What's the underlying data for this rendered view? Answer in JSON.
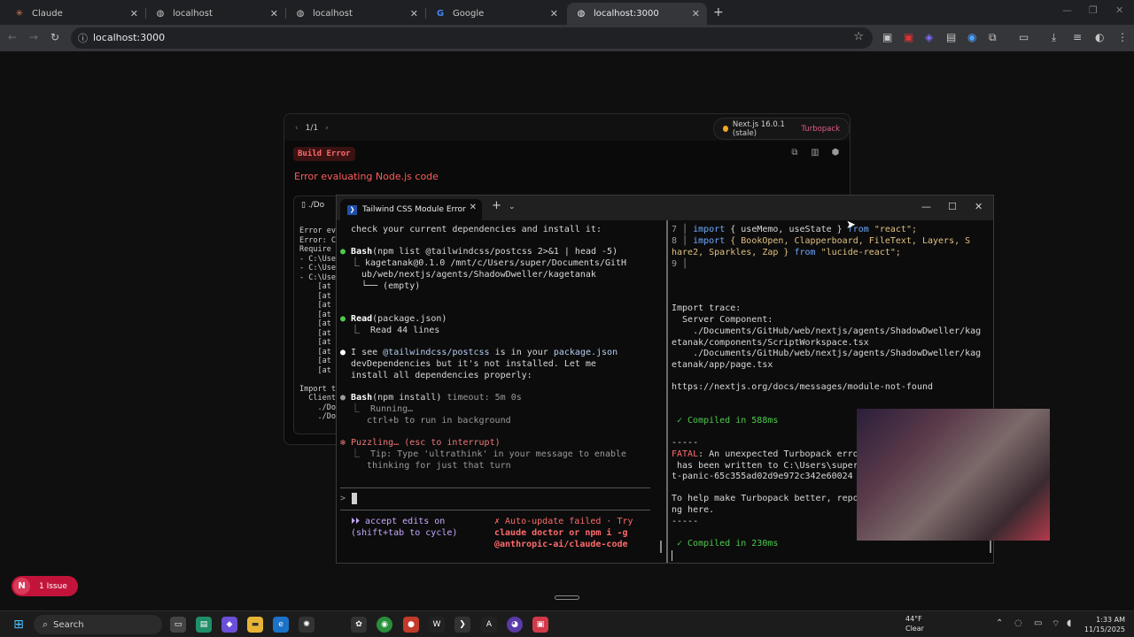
{
  "browser": {
    "tabs": [
      {
        "title": "Claude",
        "active": false
      },
      {
        "title": "localhost",
        "active": false
      },
      {
        "title": "localhost",
        "active": false
      },
      {
        "title": "Google",
        "active": false
      },
      {
        "title": "localhost:3000",
        "active": true
      }
    ],
    "url": "localhost:3000"
  },
  "overlay": {
    "pager": "1/1",
    "nextjs_version": "Next.js 16.0.1 (stale)",
    "bundler": "Turbopack",
    "badge": "Build Error",
    "title": "Error evaluating Node.js code",
    "file": "./Do",
    "code_lines": [
      "Error eva",
      "Error: Ca",
      "Require s",
      "- C:\\User",
      "- C:\\User",
      "- C:\\User",
      "    [at K",
      "    [at c",
      "    [at s",
      "    [at K",
      "    [at t",
      "    [at v",
      "    [at K",
      "    [at b",
      "    [at a",
      "    [at r",
      "",
      "Import tr",
      "  Client",
      "    ./Doc",
      "    ./Doc"
    ]
  },
  "terminal": {
    "tab_title": "Tailwind CSS Module Error",
    "left": {
      "l1": "check your current dependencies and install it:",
      "bash1_cmd": "Bash",
      "bash1_args": "(npm list @tailwindcss/postcss 2>&1 | head -5)",
      "bash1_out1": "⎿ kagetanak@0.1.0 /mnt/c/Users/super/Documents/GitH",
      "bash1_out2": "  ub/web/nextjs/agents/ShadowDweller/kagetanak",
      "bash1_out3": "  └── (empty)",
      "read_cmd": "Read",
      "read_args": "(package.json)",
      "read_out": "⎿  Read 44 lines",
      "see_pre": "I see ",
      "see_pkg": "@tailwindcss/postcss",
      "see_mid": " is in your ",
      "see_file": "package.json",
      "see_2": "devDependencies but it's not installed. Let me",
      "see_3": "install all dependencies properly:",
      "bash2_cmd": "Bash",
      "bash2_args": "(npm install)",
      "bash2_timeout": " timeout: 5m 0s",
      "bash2_out1": "⎿  Running…",
      "bash2_out2": "   ctrl+b to run in background",
      "puzzling": "✻ Puzzling… (esc to interrupt)",
      "tip1": "⎿  Tip: Type 'ultrathink' in your message to enable",
      "tip2": "   thinking for just that turn",
      "prompt": ">",
      "accept1": "⏵⏵ accept edits on",
      "accept2": "(shift+tab to cycle)",
      "upd1": "✗ Auto-update failed · Try",
      "upd2": "claude doctor or npm i -g",
      "upd3": "@anthropic-ai/claude-code"
    },
    "right": {
      "ln7": "7",
      "ln7_code_a": "import",
      "ln7_code_b": " { useMemo, useState } ",
      "ln7_code_c": "from",
      "ln7_code_d": " \"react\";",
      "ln8": "8",
      "ln8_code_a": "import",
      "ln8_code_b": " { BookOpen, Clapperboard, FileText, Layers, S",
      "ln8_wrap_b": "hare2, Sparkles, Zap } ",
      "ln8_code_c": "from",
      "ln8_code_d": " \"lucide-react\";",
      "ln9": "9",
      "trace": "Import trace:",
      "server": "  Server Component:",
      "p1a": "    ./Documents/GitHub/web/nextjs/agents/ShadowDweller/kag",
      "p1b": "etanak/components/ScriptWorkspace.tsx",
      "p2a": "    ./Documents/GitHub/web/nextjs/agents/ShadowDweller/kag",
      "p2b": "etanak/app/page.tsx",
      "doc_url": "https://nextjs.org/docs/messages/module-not-found",
      "compiled1": "✓ Compiled in 588ms",
      "dash1": "-----",
      "fatal_label": "FATAL",
      "fatal_text": ": An unexpected Turbopack erro",
      "fatal2": " has been written to C:\\Users\\super",
      "fatal3": "t-panic-65c355ad02d9e972c342e60024",
      "help1": "To help make Turbopack better, repo",
      "help2": "ng here.",
      "dash2": "-----",
      "compiled2": "✓ Compiled in 230ms"
    }
  },
  "issue_badge": {
    "letter": "N",
    "label": "1 Issue"
  },
  "taskbar": {
    "search": "Search",
    "weather_temp": "44°F",
    "weather_cond": "Clear",
    "time": "1:33 AM",
    "date": "11/15/2025"
  }
}
